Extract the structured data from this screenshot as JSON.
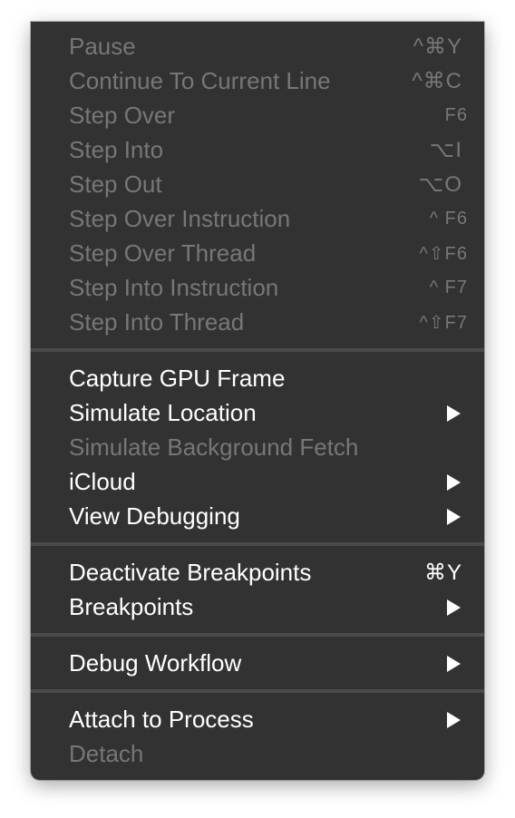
{
  "menu": {
    "group1": [
      {
        "label": "Pause",
        "shortcut": "^⌘Y",
        "enabled": false
      },
      {
        "label": "Continue To Current Line",
        "shortcut": "^⌘C",
        "enabled": false
      },
      {
        "label": "Step Over",
        "shortcut": "F6",
        "enabled": false
      },
      {
        "label": "Step Into",
        "shortcut": "⌥I",
        "enabled": false
      },
      {
        "label": "Step Out",
        "shortcut": "⌥O",
        "enabled": false
      },
      {
        "label": "Step Over Instruction",
        "shortcut": "^ F6",
        "enabled": false
      },
      {
        "label": "Step Over Thread",
        "shortcut": "^⇧F6",
        "enabled": false
      },
      {
        "label": "Step Into Instruction",
        "shortcut": "^ F7",
        "enabled": false
      },
      {
        "label": "Step Into Thread",
        "shortcut": "^⇧F7",
        "enabled": false
      }
    ],
    "group2": [
      {
        "label": "Capture GPU Frame",
        "enabled": true
      },
      {
        "label": "Simulate Location",
        "enabled": true,
        "submenu": true
      },
      {
        "label": "Simulate Background Fetch",
        "enabled": false
      },
      {
        "label": "iCloud",
        "enabled": true,
        "submenu": true
      },
      {
        "label": "View Debugging",
        "enabled": true,
        "submenu": true
      }
    ],
    "group3": [
      {
        "label": "Deactivate Breakpoints",
        "shortcut": "⌘Y",
        "enabled": true
      },
      {
        "label": "Breakpoints",
        "enabled": true,
        "submenu": true
      }
    ],
    "group4": [
      {
        "label": "Debug Workflow",
        "enabled": true,
        "submenu": true
      }
    ],
    "group5": [
      {
        "label": "Attach to Process",
        "enabled": true,
        "submenu": true
      },
      {
        "label": "Detach",
        "enabled": false
      }
    ],
    "colors": {
      "background": "#323232",
      "enabled_text": "#ffffff",
      "disabled_text": "#777777",
      "separator": "#4a4a4a"
    },
    "icons": {
      "submenu": "submenu-arrow-icon"
    }
  }
}
